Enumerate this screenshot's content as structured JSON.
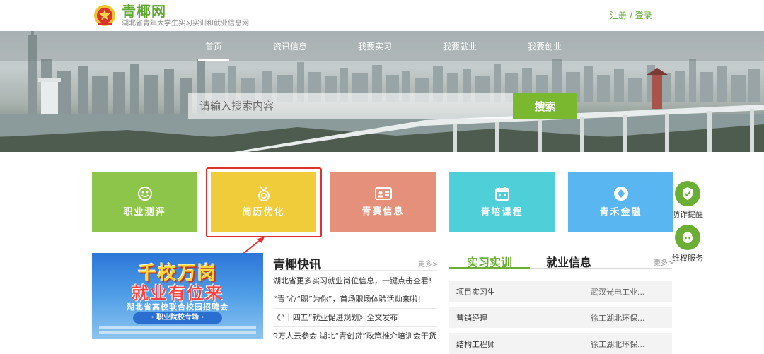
{
  "header": {
    "site_name": "青椰网",
    "site_subtitle": "湖北省青年大学生实习实训和就业信息网",
    "register": "注册",
    "separator": "/",
    "login": "登录"
  },
  "nav": {
    "items": [
      {
        "label": "首页",
        "active": true
      },
      {
        "label": "资讯信息",
        "active": false
      },
      {
        "label": "我要实习",
        "active": false
      },
      {
        "label": "我要就业",
        "active": false
      },
      {
        "label": "我要创业",
        "active": false
      }
    ]
  },
  "search": {
    "placeholder": "请输入搜索内容",
    "button": "搜索"
  },
  "tiles": [
    {
      "label": "职业测评",
      "color": "#8dc54a",
      "icon": "smiley-icon"
    },
    {
      "label": "简历优化",
      "color": "#f0cc3a",
      "icon": "medal-icon"
    },
    {
      "label": "青赛信息",
      "color": "#e5907a",
      "icon": "id-card-icon"
    },
    {
      "label": "青培课程",
      "color": "#4fd0d8",
      "icon": "calendar-icon"
    },
    {
      "label": "青禾金融",
      "color": "#5ab6f0",
      "icon": "diamond-icon"
    }
  ],
  "floating": {
    "fraud_alert": "防诈提醒",
    "rights_service": "维权服务"
  },
  "poster": {
    "line1": "千校万岗",
    "line2": "就业有位来",
    "line3": "湖北省高校联合校园招聘会",
    "line4": "· 职业院校专场 ·"
  },
  "news": {
    "title": "青椰快讯",
    "more": "更多>",
    "items": [
      "湖北省更多实习就业岗位信息，一键点击查看!",
      "“青”心“职”为你”，首场职场体验活动来啦!",
      "《“十四五”就业促进规划》全文发布",
      "9万人云参会 湖北“青创贷”政策推介培训会干货..."
    ]
  },
  "jobs": {
    "tab_internship": "实习实训",
    "tab_employment": "就业信息",
    "more": "更多>",
    "rows": [
      {
        "title": "项目实习生",
        "company": "武汉光电工业..."
      },
      {
        "title": "营销经理",
        "company": "徐工湖北环保..."
      },
      {
        "title": "结构工程师",
        "company": "徐工湖北环保..."
      }
    ]
  },
  "colors": {
    "brand_green": "#6aae34",
    "search_button": "#7ab830",
    "highlight_red": "#e03030"
  }
}
